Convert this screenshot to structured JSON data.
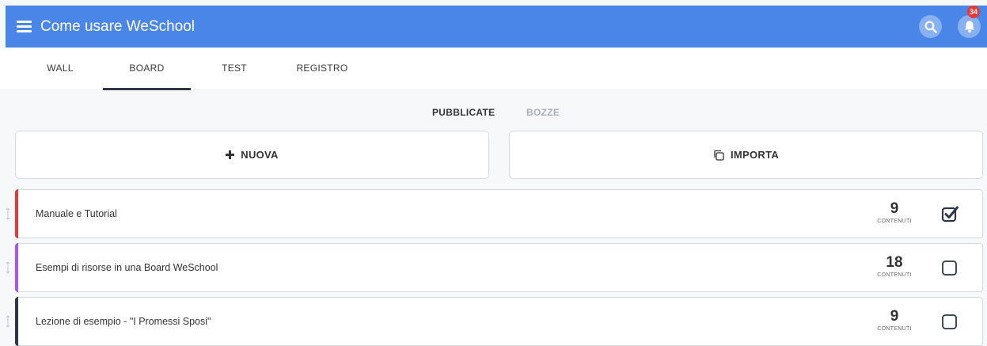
{
  "header": {
    "app_title": "Come usare WeSchool",
    "menu_icon": "hamburger-icon",
    "search_icon": "search-icon",
    "bell_icon": "bell-icon",
    "notification_count": "34",
    "bar_color": "#4a86e8",
    "badge_color": "#e53935"
  },
  "tabs": [
    {
      "label": "WALL",
      "active": false
    },
    {
      "label": "BOARD",
      "active": true
    },
    {
      "label": "TEST",
      "active": false
    },
    {
      "label": "REGISTRO",
      "active": false
    }
  ],
  "filter": {
    "published_label": "PUBBLICATE",
    "drafts_label": "BOZZE",
    "active": "PUBBLICATE"
  },
  "actions": {
    "new_label": "NUOVA",
    "new_icon": "plus-icon",
    "import_label": "IMPORTA",
    "import_icon": "copy-icon"
  },
  "boards": [
    {
      "title": "Manuale e Tutorial",
      "count": "9",
      "count_label": "CONTENUTI",
      "accent_color": "#e53935",
      "checked": true
    },
    {
      "title": "Esempi di risorse in una Board WeSchool",
      "count": "18",
      "count_label": "CONTENUTI",
      "accent_color": "#a855f7",
      "checked": false
    },
    {
      "title": "Lezione di esempio - \"I Promessi Sposi\"",
      "count": "9",
      "count_label": "CONTENUTI",
      "accent_color": "#2d3748",
      "checked": false
    }
  ]
}
